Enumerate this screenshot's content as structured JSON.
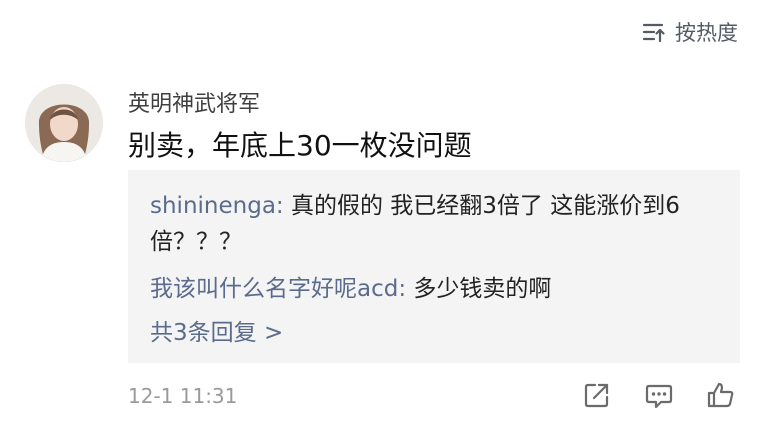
{
  "header": {
    "sort_label": "按热度",
    "sort_icon": "sort-icon"
  },
  "comment": {
    "avatar_icon": "user-avatar",
    "username": "英明神武将军",
    "text": "别卖，年底上30一枚没问题",
    "timestamp": "12-1 11:31"
  },
  "replies": [
    {
      "author": "shininenga:",
      "text": " 真的假的 我已经翻3倍了 这能涨价到6倍？？？"
    },
    {
      "author": "我该叫什么名字好呢acd:",
      "text": " 多少钱卖的啊"
    }
  ],
  "more_replies": "共3条回复 >",
  "actions": [
    "share-icon",
    "comment-icon",
    "like-icon"
  ],
  "colors": {
    "link": "#5b6b8c",
    "reply_bg": "#f4f4f5"
  }
}
